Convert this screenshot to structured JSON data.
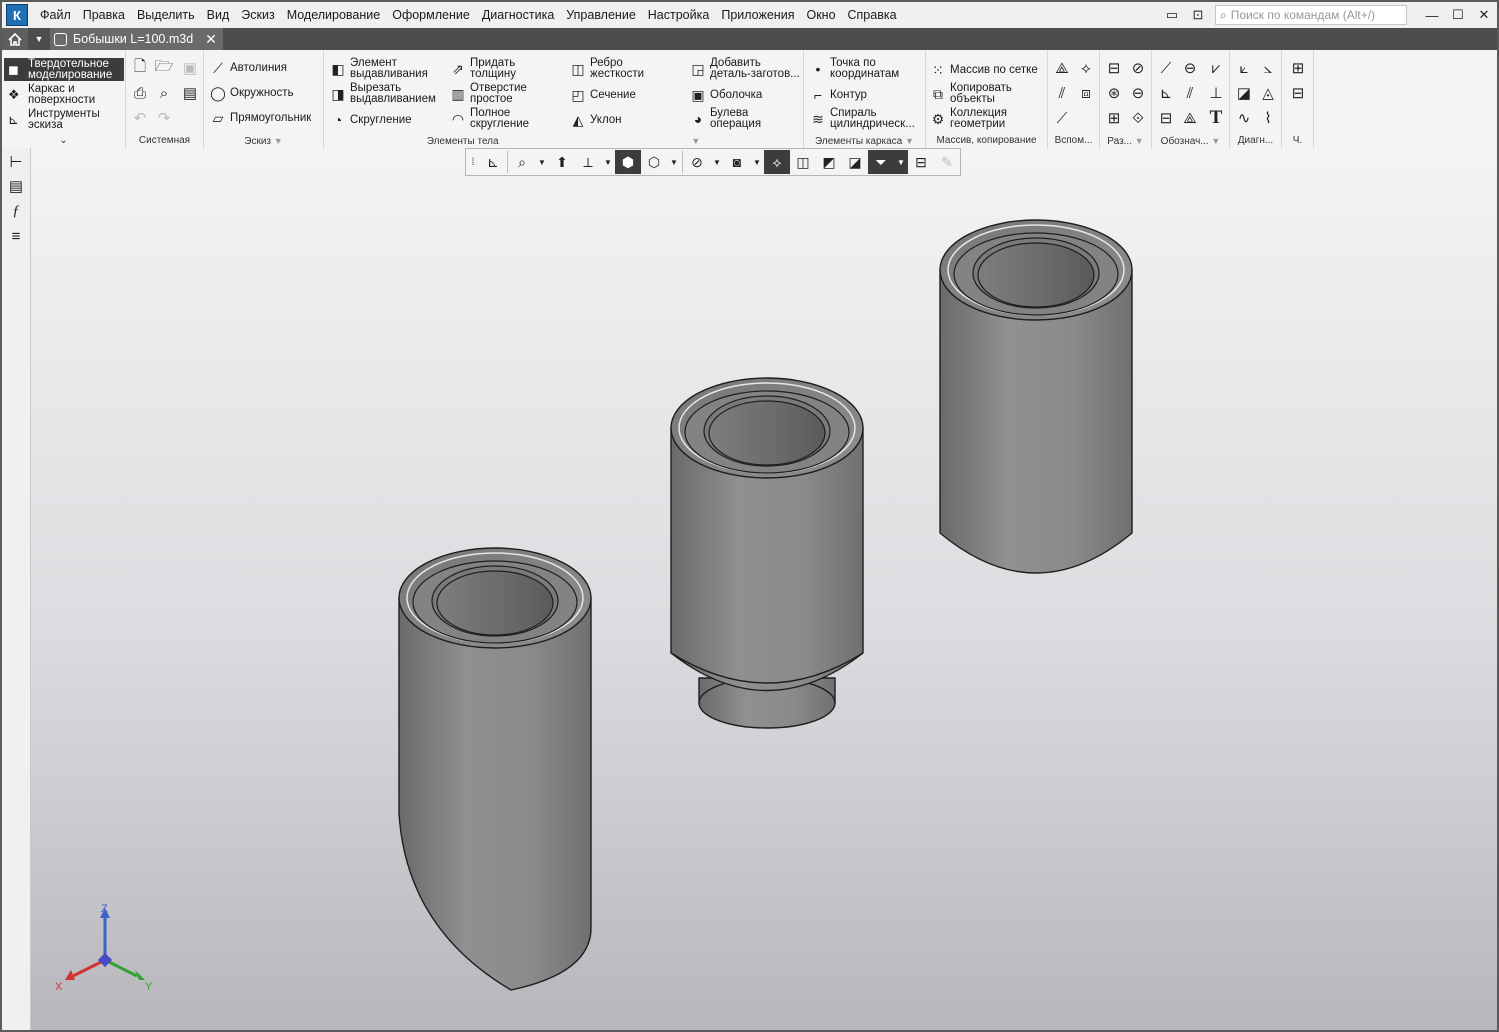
{
  "menu": {
    "logo": "К",
    "items": [
      "Файл",
      "Правка",
      "Выделить",
      "Вид",
      "Эскиз",
      "Моделирование",
      "Оформление",
      "Диагностика",
      "Управление",
      "Настройка",
      "Приложения",
      "Окно",
      "Справка"
    ],
    "search_placeholder": "Поиск по командам (Alt+/)"
  },
  "tab": {
    "title": "Бобышки L=100.m3d",
    "close": "✕"
  },
  "ribbon": {
    "modes": [
      "Твердотельное моделирование",
      "Каркас и поверхности",
      "Инструменты эскиза"
    ],
    "sketch": [
      "Автолиния",
      "Окружность",
      "Прямоугольник"
    ],
    "body1": [
      "Элемент выдавливания",
      "Вырезать выдавливанием",
      "Скругление"
    ],
    "body2": [
      "Придать толщину",
      "Отверстие простое",
      "Полное скругление"
    ],
    "body3": [
      "Ребро жесткости",
      "Сечение",
      "Уклон"
    ],
    "body4": [
      "Добавить деталь-заготов...",
      "Оболочка",
      "Булева операция"
    ],
    "frame": [
      "Точка по координатам",
      "Контур",
      "Спираль цилиндрическ..."
    ],
    "array": [
      "Массив по сетке",
      "Копировать объекты",
      "Коллекция геометрии"
    ],
    "group_labels": {
      "system": "Системная",
      "sketch": "Эскиз",
      "body": "Элементы тела",
      "frame": "Элементы каркаса",
      "array": "Массив, копирование",
      "aux": "Вспом...",
      "dim": "Раз...",
      "notation": "Обознач...",
      "diag": "Диагн...",
      "ch": "Ч."
    }
  },
  "axes": {
    "x": "X",
    "y": "Y",
    "z": "Z"
  },
  "colors": {
    "active_mode": "#3c3c3c",
    "tab_bar": "#4d4d4d",
    "part": "#8c8c8c",
    "axis_x": "#d23232",
    "axis_y": "#32a032",
    "axis_z": "#3c64c8"
  }
}
